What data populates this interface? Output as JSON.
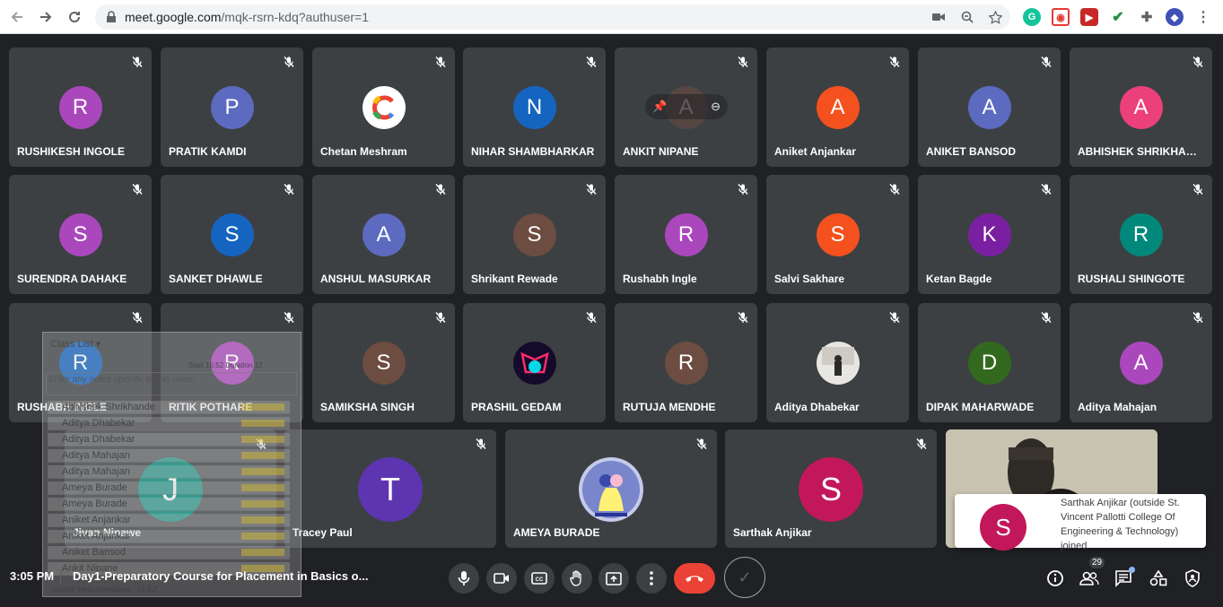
{
  "browser": {
    "url_host": "meet.google.com",
    "url_path": "/mqk-rsrn-kdq?authuser=1"
  },
  "grid_rows": [
    [
      "RUSHIKESH INGOLE",
      "PRATIK KAMDI",
      "Chetan Meshram",
      "NIHAR SHAMBHARKAR",
      "ANKIT NIPANE",
      "Aniket Anjankar",
      "ANIKET BANSOD",
      "ABHISHEK SHRIKHANDK..."
    ],
    [
      "SURENDRA DAHAKE",
      "SANKET DHAWLE",
      "ANSHUL MASURKAR",
      "Shrikant Rewade",
      "Rushabh Ingle",
      "Salvi Sakhare",
      "Ketan Bagde",
      "RUSHALI SHINGOTE"
    ],
    [
      "RUSHABH INGLE",
      "RITIK POTHARE",
      "SAMIKSHA SINGH",
      "PRASHIL GEDAM",
      "RUTUJA MENDHE",
      "Aditya Dhabekar",
      "DIPAK MAHARWADE",
      "Aditya Mahajan"
    ]
  ],
  "grid_initials": [
    [
      "R",
      "P",
      "",
      "N",
      "A",
      "A",
      "A",
      "A"
    ],
    [
      "S",
      "S",
      "A",
      "S",
      "R",
      "S",
      "K",
      "R"
    ],
    [
      "R",
      "R",
      "S",
      "",
      "R",
      "",
      "D",
      "A"
    ]
  ],
  "bottom_row": [
    {
      "name": "Jivan Ninawe",
      "initial": "J"
    },
    {
      "name": "Tracey Paul",
      "initial": "T"
    },
    {
      "name": "AMEYA BURADE",
      "initial": ""
    },
    {
      "name": "Sarthak Anjikar",
      "initial": "S"
    }
  ],
  "avatar_colors": {
    "purple": "#7b1fa2",
    "indigo": "#5c6bc0",
    "blue": "#1565c0",
    "orange": "#f4511e",
    "pink": "#ec407a",
    "magenta": "#ab47bc",
    "brown": "#6d4c41",
    "teal": "#00897b",
    "green": "#33691e",
    "crimson": "#c2185b",
    "violet": "#5e35b1"
  },
  "overlay": {
    "title": "Class List",
    "notes_placeholder": "Enter any notes specific to this class.",
    "stats": "Start 15:52  Duration 12",
    "entries": [
      "Abhishek Shrikhande",
      "Aditya Dhabekar",
      "Aditya Dhabekar",
      "Aditya Mahajan",
      "Aditya Mahajan",
      "Ameya Burade",
      "Ameya Burade",
      "Aniket Anjankar",
      "Aniket Anjankar",
      "Aniket Bansod",
      "Ankit Nipane"
    ],
    "footer": "Google Meet Attendance · v1.5.2"
  },
  "toast": {
    "initial": "S",
    "message": "Sarthak Anjikar (outside St. Vincent Pallotti College Of Engineering & Technology) joined"
  },
  "bottom_bar": {
    "time": "3:05 PM",
    "meeting_title": "Day1-Preparatory Course for Placement in Basics o...",
    "participants_count": "29"
  }
}
